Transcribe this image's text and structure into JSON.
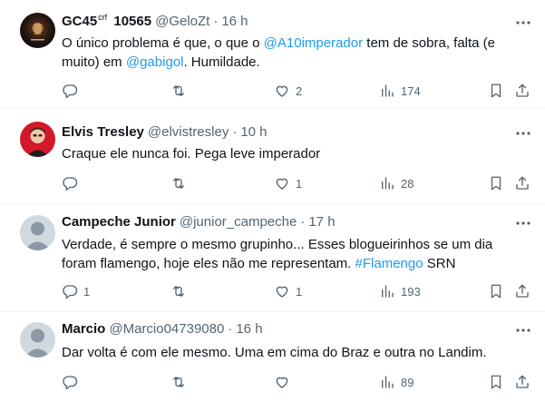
{
  "tweets": [
    {
      "name": "GC45",
      "badge": "crf",
      "name_suffix": " 10565",
      "handle": "@GeloZt",
      "dot": "·",
      "time": "16 h",
      "text_parts": [
        "O único problema é que, o que o ",
        "@A10imperador",
        " tem de sobra, falta (e muito) em ",
        "@gabigol",
        ". Humildade."
      ],
      "reply_count": "",
      "retweet_count": "",
      "like_count": "2",
      "view_count": "174",
      "avatar_icon": "profile-photo-dark"
    },
    {
      "name": "Elvis Tresley",
      "handle": "@elvistresley",
      "dot": "·",
      "time": "10 h",
      "text": "Craque ele nunca foi. Pega leve imperador",
      "reply_count": "",
      "retweet_count": "",
      "like_count": "1",
      "view_count": "28",
      "avatar_icon": "profile-photo-red"
    },
    {
      "name": "Campeche Junior",
      "handle": "@junior_campeche",
      "dot": "·",
      "time": "17 h",
      "text_parts": [
        "Verdade, é sempre o mesmo grupinho... Esses blogueirinhos se um dia foram flamengo, hoje eles não me representam. ",
        "#Flamengo",
        " SRN"
      ],
      "reply_count": "1",
      "retweet_count": "",
      "like_count": "1",
      "view_count": "193",
      "avatar_icon": "default-avatar"
    },
    {
      "name": "Marcio",
      "handle": "@Marcio04739080",
      "dot": "·",
      "time": "16 h",
      "text": "Dar volta é com ele mesmo. Uma em cima do Braz e outra no Landim.",
      "reply_count": "",
      "retweet_count": "",
      "like_count": "",
      "view_count": "89",
      "avatar_icon": "default-avatar"
    }
  ],
  "colors": {
    "link": "#1d9bf0",
    "muted": "#536471",
    "text": "#0f1419",
    "divider": "#eff3f4"
  },
  "icons": [
    "more-icon",
    "reply-icon",
    "retweet-icon",
    "like-icon",
    "views-icon",
    "bookmark-icon",
    "share-icon"
  ]
}
